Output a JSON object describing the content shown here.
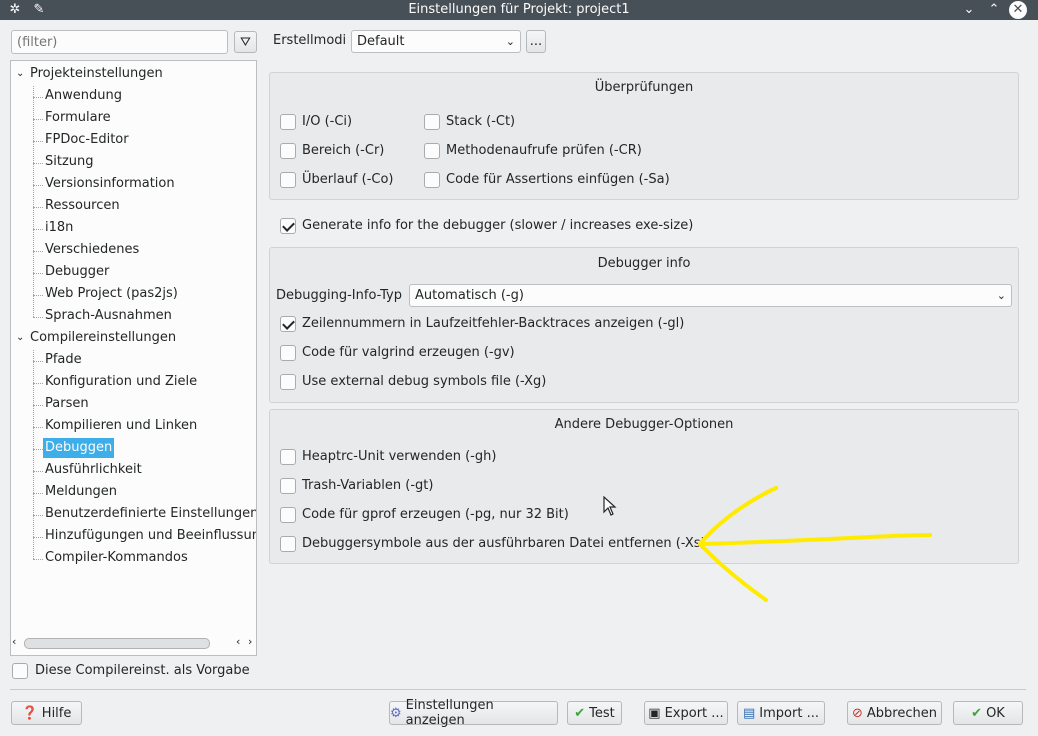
{
  "window": {
    "title": "Einstellungen für Projekt: project1"
  },
  "filter": {
    "placeholder": "(filter)"
  },
  "build_mode": {
    "label": "Erstellmodi",
    "value": "Default",
    "more_label": "..."
  },
  "tree": {
    "groups": [
      {
        "label": "Projekteinstellungen",
        "items": [
          "Anwendung",
          "Formulare",
          "FPDoc-Editor",
          "Sitzung",
          "Versionsinformation",
          "Ressourcen",
          "i18n",
          "Verschiedenes",
          "Debugger",
          "Web Project (pas2js)",
          "Sprach-Ausnahmen"
        ]
      },
      {
        "label": "Compilereinstellungen",
        "items": [
          "Pfade",
          "Konfiguration und Ziele",
          "Parsen",
          "Kompilieren und Linken",
          "Debuggen",
          "Ausführlichkeit",
          "Meldungen",
          "Benutzerdefinierte Einstellungen",
          "Hinzufügungen und Beeinflussungen",
          "Compiler-Kommandos"
        ]
      }
    ],
    "selected": "Debuggen"
  },
  "default_checkbox": {
    "label": "Diese Compilereinst. als Vorgabe",
    "checked": false
  },
  "checks_group": {
    "title": "Überprüfungen",
    "left": [
      {
        "label": "I/O (-Ci)",
        "checked": false
      },
      {
        "label": "Bereich (-Cr)",
        "checked": false
      },
      {
        "label": "Überlauf (-Co)",
        "checked": false
      }
    ],
    "right": [
      {
        "label": "Stack (-Ct)",
        "checked": false
      },
      {
        "label": "Methodenaufrufe prüfen (-CR)",
        "checked": false
      },
      {
        "label": "Code für Assertions einfügen (-Sa)",
        "checked": false
      }
    ]
  },
  "generate_debug": {
    "label": "Generate info for the debugger (slower / increases exe-size)",
    "checked": true
  },
  "debugger_info": {
    "title": "Debugger info",
    "type_label": "Debugging-Info-Typ",
    "type_value": "Automatisch (-g)",
    "options": [
      {
        "label": "Zeilennummern in Laufzeitfehler-Backtraces anzeigen (-gl)",
        "checked": true
      },
      {
        "label": "Code für valgrind erzeugen (-gv)",
        "checked": false
      },
      {
        "label": "Use external debug symbols file (-Xg)",
        "checked": false
      }
    ]
  },
  "other_debug": {
    "title": "Andere Debugger-Optionen",
    "options": [
      {
        "label": "Heaptrc-Unit verwenden (-gh)",
        "checked": false
      },
      {
        "label": "Trash-Variablen (-gt)",
        "checked": false
      },
      {
        "label": "Code für gprof erzeugen (-pg, nur 32 Bit)",
        "checked": false
      },
      {
        "label": "Debuggersymbole aus der ausführbaren Datei entfernen (-Xs)",
        "checked": false
      }
    ]
  },
  "buttons": {
    "help": "Hilfe",
    "show_options": "Einstellungen anzeigen",
    "test": "Test",
    "export": "Export ...",
    "import": "Import ...",
    "cancel": "Abbrechen",
    "ok": "OK"
  },
  "colors": {
    "accent": "#3daee9",
    "annotation": "#ffeb00",
    "titlebar": "#475057"
  }
}
